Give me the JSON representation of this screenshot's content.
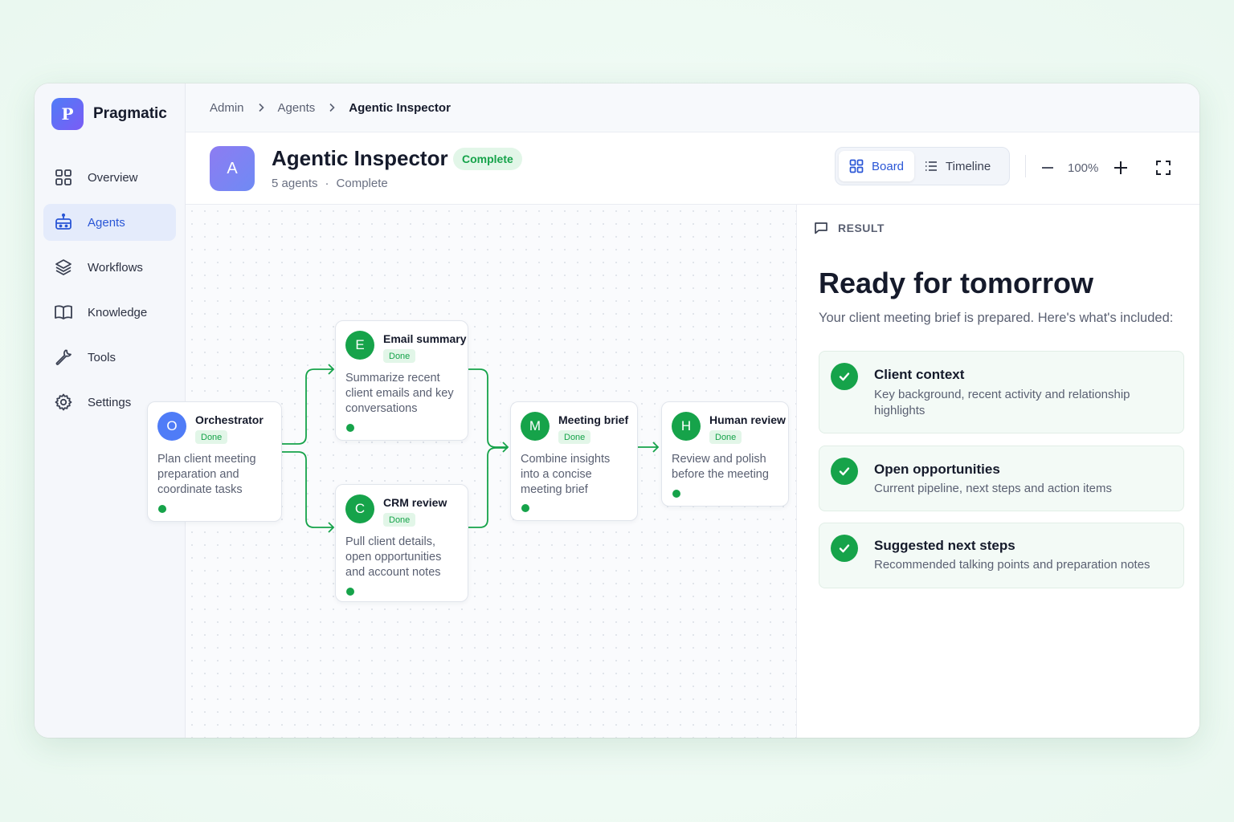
{
  "app": {
    "name": "Pragmatic",
    "logo_letter": "P"
  },
  "sidebar": {
    "items": [
      {
        "label": "Overview",
        "icon": "grid-icon"
      },
      {
        "label": "Agents",
        "icon": "robot-icon",
        "active": true
      },
      {
        "label": "Workflows",
        "icon": "layers-icon"
      },
      {
        "label": "Knowledge",
        "icon": "book-icon"
      },
      {
        "label": "Tools",
        "icon": "wrench-icon"
      },
      {
        "label": "Settings",
        "icon": "gear-icon"
      }
    ]
  },
  "breadcrumb": [
    "Admin",
    "Agents",
    "Agentic Inspector"
  ],
  "header": {
    "avatar_letter": "A",
    "title": "Agentic Inspector",
    "status": "Complete",
    "subtitle_count": "5 agents",
    "subtitle_status": "Complete"
  },
  "view_toggle": {
    "board_label": "Board",
    "timeline_label": "Timeline",
    "active": "Board"
  },
  "zoom": {
    "level": "100%"
  },
  "workflow": {
    "nodes": [
      {
        "id": "orchestrator",
        "letter": "O",
        "title": "Orchestrator",
        "status": "Done",
        "description": [
          "Plan client meeting",
          "preparation and",
          "coordinate tasks"
        ],
        "color": "#4f7cf7"
      },
      {
        "id": "email",
        "letter": "E",
        "title": "Email summary",
        "status": "Done",
        "description": [
          "Summarize recent",
          "client emails and key",
          "conversations"
        ],
        "color": "#16a34a"
      },
      {
        "id": "crm",
        "letter": "C",
        "title": "CRM review",
        "status": "Done",
        "description": [
          "Pull client details,",
          "open opportunities",
          "and account notes"
        ],
        "color": "#16a34a"
      },
      {
        "id": "brief",
        "letter": "M",
        "title": "Meeting brief",
        "status": "Done",
        "description": [
          "Combine insights",
          "into a concise",
          "meeting brief"
        ],
        "color": "#16a34a"
      },
      {
        "id": "human",
        "letter": "H",
        "title": "Human review",
        "status": "Done",
        "description": [
          "Review and polish",
          "before the meeting"
        ],
        "color": "#16a34a"
      }
    ]
  },
  "result": {
    "label": "RESULT",
    "title": "Ready for tomorrow",
    "subtitle": "Your client meeting brief is prepared. Here's what's included:",
    "items": [
      {
        "title": "Client context",
        "description": [
          "Key background, recent activity and relationship",
          "highlights"
        ]
      },
      {
        "title": "Open opportunities",
        "description": [
          "Current pipeline, next steps and action items"
        ]
      },
      {
        "title": "Suggested next steps",
        "description": [
          "Recommended talking points and preparation notes"
        ]
      }
    ]
  },
  "colors": {
    "accent": "#2a56d6",
    "success": "#16a34a",
    "success_bg": "#e2f6e8"
  }
}
